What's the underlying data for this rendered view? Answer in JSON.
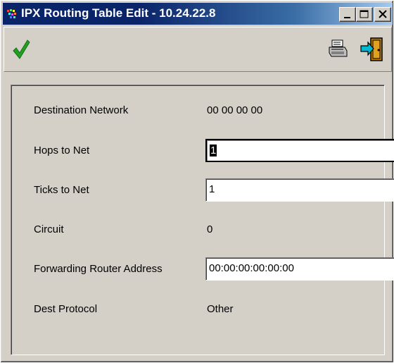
{
  "window": {
    "title": "IPX Routing Table Edit - 10.24.22.8"
  },
  "toolbar": {
    "apply_icon": "checkmark-icon",
    "print_icon": "printer-icon",
    "exit_icon": "exit-door-icon",
    "accent_green": "#1e9a1e"
  },
  "form": {
    "destination_network": {
      "label": "Destination Network",
      "value": "00 00 00 00"
    },
    "hops_to_net": {
      "label": "Hops to Net",
      "value": "1"
    },
    "ticks_to_net": {
      "label": "Ticks to Net",
      "value": "1"
    },
    "circuit": {
      "label": "Circuit",
      "value": "0"
    },
    "forwarding_router_address": {
      "label": "Forwarding Router Address",
      "value": "00:00:00:00:00:00"
    },
    "dest_protocol": {
      "label": "Dest Protocol",
      "value": "Other"
    }
  }
}
